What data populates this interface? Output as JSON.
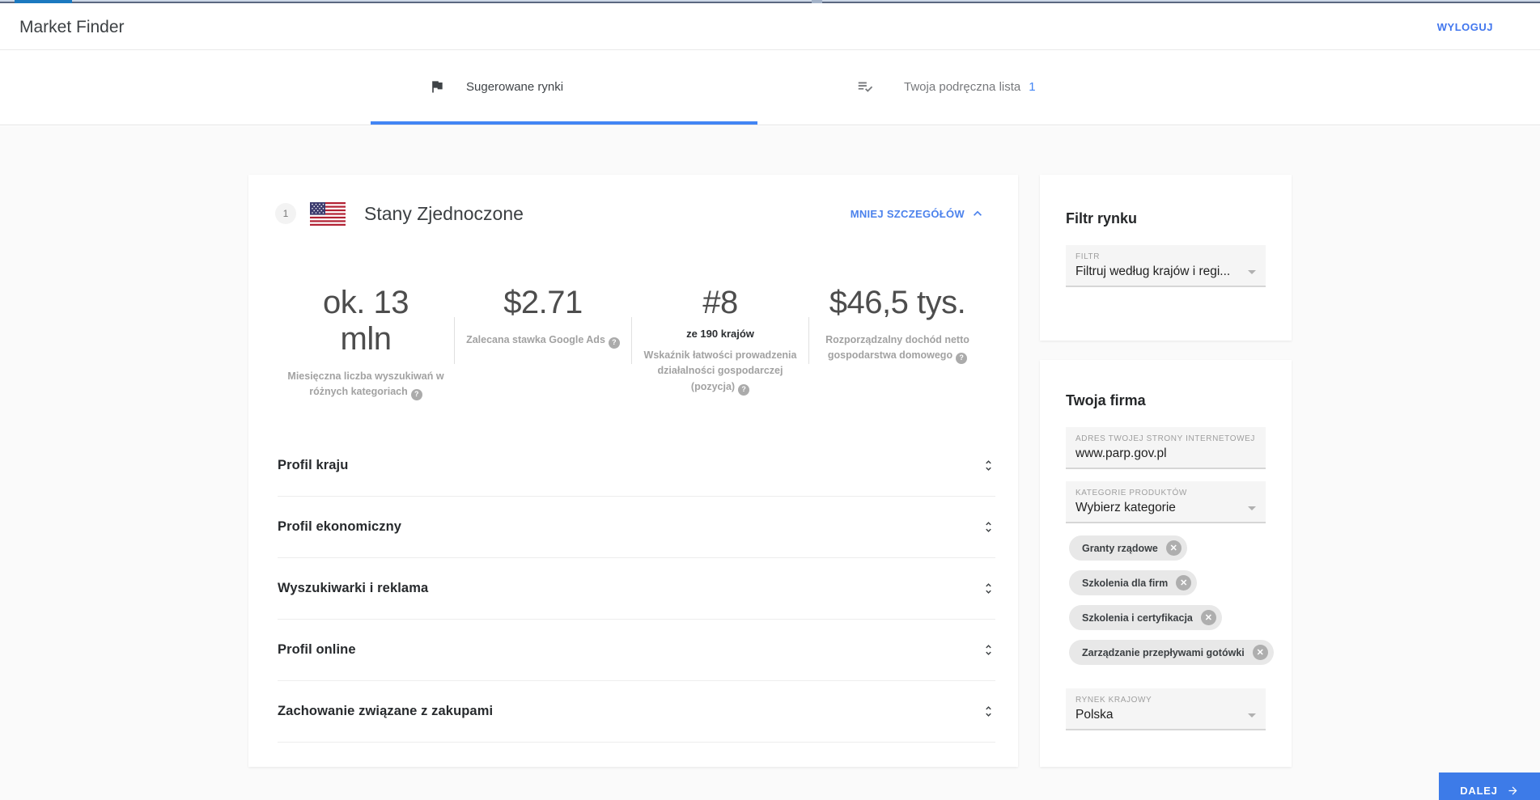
{
  "header": {
    "title": "Market Finder",
    "logout_label": "WYLOGUJ"
  },
  "tabs": [
    {
      "label": "Sugerowane rynki",
      "active": true
    },
    {
      "label": "Twoja podręczna lista",
      "badge": "1",
      "active": false
    }
  ],
  "market_card": {
    "rank": "1",
    "country": "Stany Zjednoczone",
    "details_toggle_label": "MNIEJ SZCZEGÓŁÓW",
    "stats": [
      {
        "value": "ok. 13 mln",
        "caption": "Miesięczna liczba wyszukiwań w różnych kategoriach"
      },
      {
        "value": "$2.71",
        "caption": "Zalecana stawka Google Ads"
      },
      {
        "value": "#8",
        "subvalue": "ze 190 krajów",
        "caption": "Wskaźnik łatwości prowadzenia działalności gospodarczej (pozycja)"
      },
      {
        "value": "$46,5 tys.",
        "caption": "Rozporządzalny dochód netto gospodarstwa domowego"
      }
    ],
    "sections": [
      {
        "label": "Profil kraju"
      },
      {
        "label": "Profil ekonomiczny"
      },
      {
        "label": "Wyszukiwarki i reklama"
      },
      {
        "label": "Profil online"
      },
      {
        "label": "Zachowanie związane z zakupami"
      }
    ]
  },
  "filter_card": {
    "title": "Filtr rynku",
    "field_label": "FILTR",
    "field_value": "Filtruj według krajów i regi..."
  },
  "company_card": {
    "title": "Twoja firma",
    "website": {
      "label": "ADRES TWOJEJ STRONY INTERNETOWEJ",
      "value": "www.parp.gov.pl"
    },
    "categories": {
      "label": "KATEGORIE PRODUKTÓW",
      "value": "Wybierz kategorie"
    },
    "chips": [
      {
        "label": "Granty rządowe"
      },
      {
        "label": "Szkolenia dla firm"
      },
      {
        "label": "Szkolenia i certyfikacja"
      },
      {
        "label": "Zarządzanie przepływami gotówki"
      }
    ],
    "home_market": {
      "label": "RYNEK KRAJOWY",
      "value": "Polska"
    }
  },
  "next_button": {
    "label": "DALEJ"
  },
  "colors": {
    "accent_blue": "#4285f4",
    "next_button_bg": "#3d7be8",
    "page_bg": "#fafafa"
  }
}
